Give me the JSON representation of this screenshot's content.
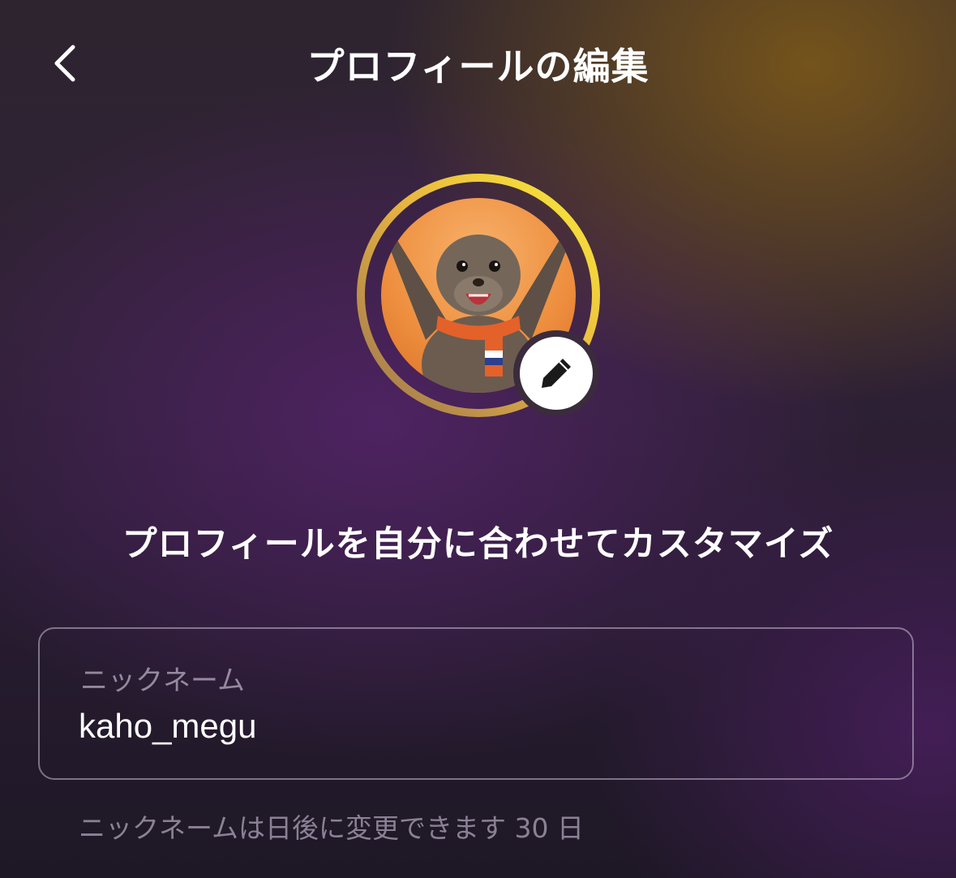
{
  "header": {
    "title": "プロフィールの編集",
    "back_icon": "chevron-left-icon"
  },
  "avatar": {
    "description_icon": "seal-avatar",
    "ring_colors": [
      "#f7e43a",
      "#e7a646",
      "#9c7550"
    ],
    "edit_icon": "pencil-icon"
  },
  "main": {
    "headline": "プロフィールを自分に合わせてカスタマイズ"
  },
  "nickname_field": {
    "label": "ニックネーム",
    "value": "kaho_megu"
  },
  "helper_text": "ニックネームは日後に変更できます 30 日",
  "colors": {
    "accent_yellow": "#f7e43a",
    "background_purple": "#2a1d33"
  }
}
